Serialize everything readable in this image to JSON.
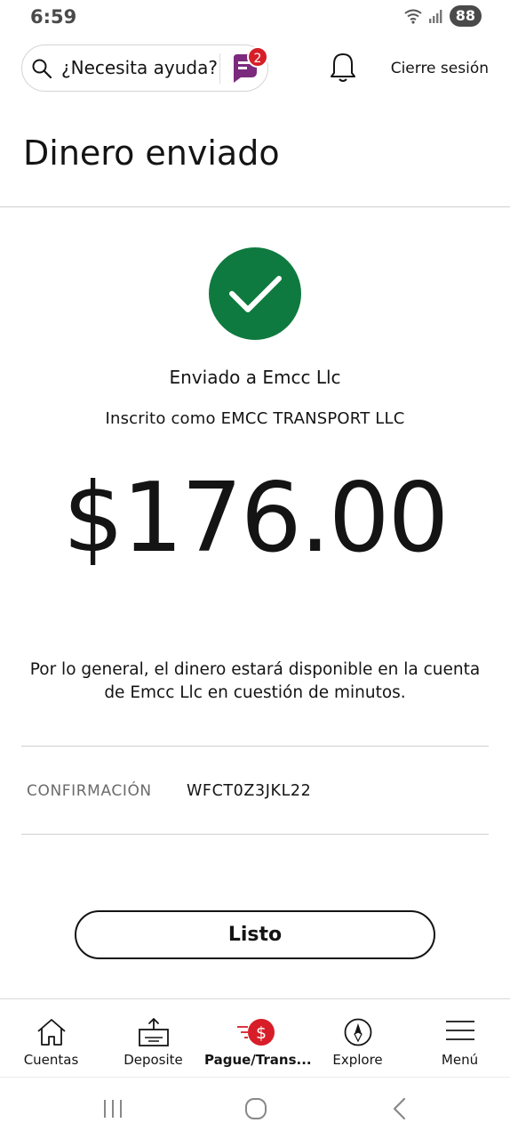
{
  "status": {
    "time": "6:59",
    "battery": "88"
  },
  "header": {
    "help_placeholder": "¿Necesita ayuda?",
    "chat_badge": "2",
    "logout": "Cierre sesión"
  },
  "page": {
    "title": "Dinero enviado"
  },
  "receipt": {
    "sent_to": "Enviado a Emcc Llc",
    "enrolled_as": "Inscrito como EMCC TRANSPORT LLC",
    "amount": "$176.00",
    "availability_line1": "Por lo general, el dinero estará disponible en la cuenta",
    "availability_line2": "de Emcc Llc en cuestión de minutos.",
    "confirmation_label": "CONFIRMACIÓN",
    "confirmation_value": "WFCT0Z3JKL22",
    "done_label": "Listo"
  },
  "nav": {
    "items": [
      {
        "label": "Cuentas",
        "icon": "home-icon",
        "active": false
      },
      {
        "label": "Deposite",
        "icon": "deposit-icon",
        "active": false
      },
      {
        "label": "Pague/Trans...",
        "icon": "pay-transfer-icon",
        "active": true
      },
      {
        "label": "Explore",
        "icon": "compass-icon",
        "active": false
      },
      {
        "label": "Menú",
        "icon": "menu-icon",
        "active": false
      }
    ]
  },
  "colors": {
    "accent_red": "#d71e28",
    "success_green": "#0f7a3f",
    "chat_purple": "#7b2a7e"
  }
}
